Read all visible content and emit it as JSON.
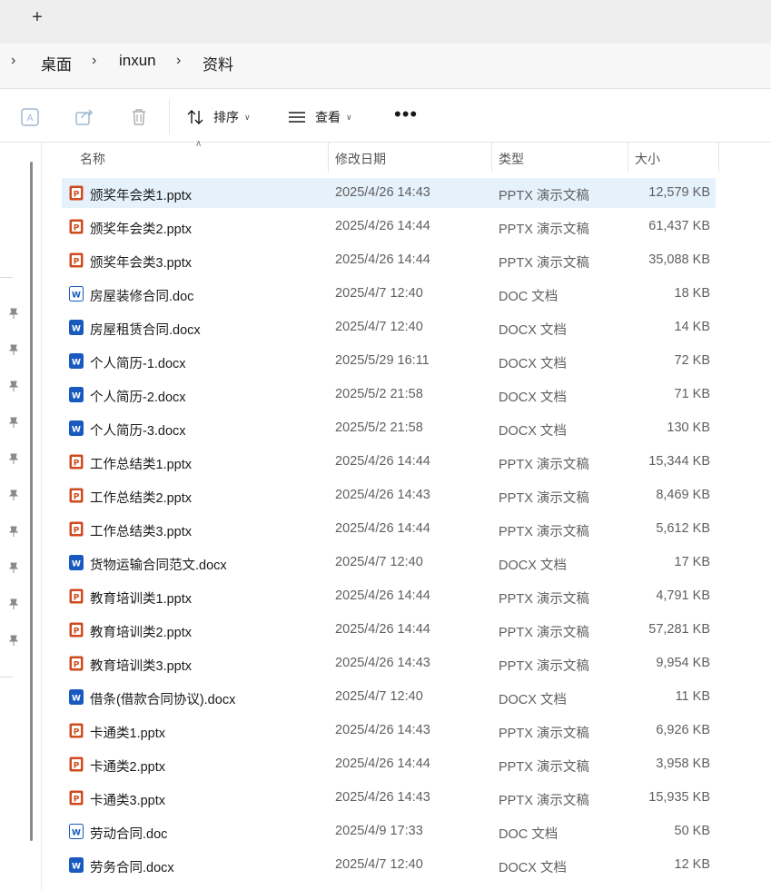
{
  "tabbar": {
    "new_tab_glyph": "+"
  },
  "breadcrumb": [
    "桌面",
    "inxun",
    "资料"
  ],
  "toolbar": {
    "sort_label": "排序",
    "view_label": "查看",
    "more_glyph": "•••"
  },
  "columns": {
    "name": "名称",
    "date": "修改日期",
    "type": "类型",
    "size": "大小"
  },
  "files": [
    {
      "name": "颁奖年会类1.pptx",
      "date": "2025/4/26 14:43",
      "type": "PPTX 演示文稿",
      "size": "12,579 KB",
      "kind": "pptx",
      "selected": true
    },
    {
      "name": "颁奖年会类2.pptx",
      "date": "2025/4/26 14:44",
      "type": "PPTX 演示文稿",
      "size": "61,437 KB",
      "kind": "pptx"
    },
    {
      "name": "颁奖年会类3.pptx",
      "date": "2025/4/26 14:44",
      "type": "PPTX 演示文稿",
      "size": "35,088 KB",
      "kind": "pptx"
    },
    {
      "name": "房屋装修合同.doc",
      "date": "2025/4/7 12:40",
      "type": "DOC 文档",
      "size": "18 KB",
      "kind": "doc"
    },
    {
      "name": "房屋租赁合同.docx",
      "date": "2025/4/7 12:40",
      "type": "DOCX 文档",
      "size": "14 KB",
      "kind": "docx"
    },
    {
      "name": "个人简历-1.docx",
      "date": "2025/5/29 16:11",
      "type": "DOCX 文档",
      "size": "72 KB",
      "kind": "docx"
    },
    {
      "name": "个人简历-2.docx",
      "date": "2025/5/2 21:58",
      "type": "DOCX 文档",
      "size": "71 KB",
      "kind": "docx"
    },
    {
      "name": "个人简历-3.docx",
      "date": "2025/5/2 21:58",
      "type": "DOCX 文档",
      "size": "130 KB",
      "kind": "docx"
    },
    {
      "name": "工作总结类1.pptx",
      "date": "2025/4/26 14:44",
      "type": "PPTX 演示文稿",
      "size": "15,344 KB",
      "kind": "pptx"
    },
    {
      "name": "工作总结类2.pptx",
      "date": "2025/4/26 14:43",
      "type": "PPTX 演示文稿",
      "size": "8,469 KB",
      "kind": "pptx"
    },
    {
      "name": "工作总结类3.pptx",
      "date": "2025/4/26 14:44",
      "type": "PPTX 演示文稿",
      "size": "5,612 KB",
      "kind": "pptx"
    },
    {
      "name": "货物运输合同范文.docx",
      "date": "2025/4/7 12:40",
      "type": "DOCX 文档",
      "size": "17 KB",
      "kind": "docx"
    },
    {
      "name": "教育培训类1.pptx",
      "date": "2025/4/26 14:44",
      "type": "PPTX 演示文稿",
      "size": "4,791 KB",
      "kind": "pptx"
    },
    {
      "name": "教育培训类2.pptx",
      "date": "2025/4/26 14:44",
      "type": "PPTX 演示文稿",
      "size": "57,281 KB",
      "kind": "pptx"
    },
    {
      "name": "教育培训类3.pptx",
      "date": "2025/4/26 14:43",
      "type": "PPTX 演示文稿",
      "size": "9,954 KB",
      "kind": "pptx"
    },
    {
      "name": "借条(借款合同协议).docx",
      "date": "2025/4/7 12:40",
      "type": "DOCX 文档",
      "size": "11 KB",
      "kind": "docx"
    },
    {
      "name": "卡通类1.pptx",
      "date": "2025/4/26 14:43",
      "type": "PPTX 演示文稿",
      "size": "6,926 KB",
      "kind": "pptx"
    },
    {
      "name": "卡通类2.pptx",
      "date": "2025/4/26 14:44",
      "type": "PPTX 演示文稿",
      "size": "3,958 KB",
      "kind": "pptx"
    },
    {
      "name": "卡通类3.pptx",
      "date": "2025/4/26 14:43",
      "type": "PPTX 演示文稿",
      "size": "15,935 KB",
      "kind": "pptx"
    },
    {
      "name": "劳动合同.doc",
      "date": "2025/4/9 17:33",
      "type": "DOC 文档",
      "size": "50 KB",
      "kind": "doc"
    },
    {
      "name": "劳务合同.docx",
      "date": "2025/4/7 12:40",
      "type": "DOCX 文档",
      "size": "12 KB",
      "kind": "docx"
    }
  ],
  "colors": {
    "pptx": "#d04a1e",
    "word": "#185abd",
    "selection": "#e5f1fb"
  },
  "icons": {
    "translate": "translate-icon",
    "share": "share-icon",
    "delete": "trash-icon",
    "sort": "sort-icon",
    "view": "view-list-icon",
    "pptx": "powerpoint-file-icon",
    "doc": "word-file-icon",
    "pin": "pin-icon"
  }
}
